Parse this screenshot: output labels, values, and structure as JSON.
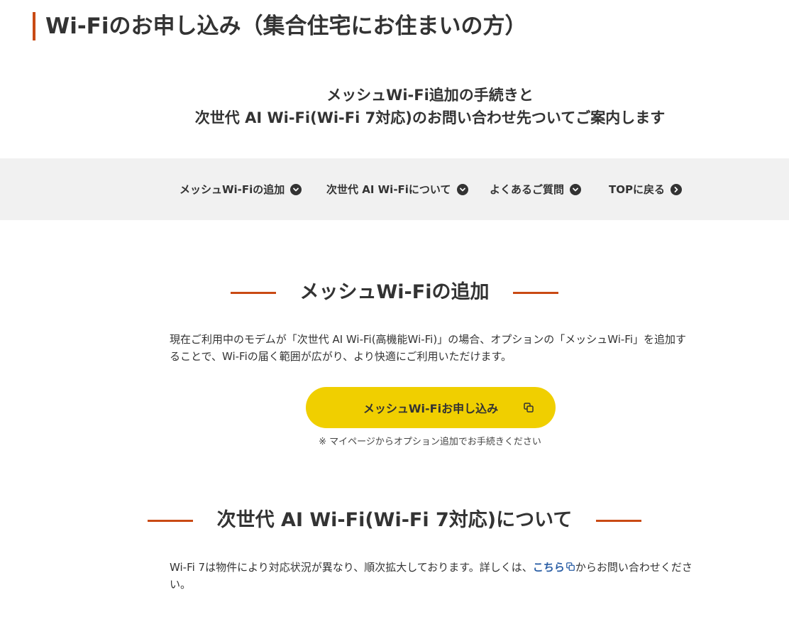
{
  "page": {
    "title": "Wi-Fiのお申し込み（集合住宅にお住まいの方）",
    "intro_line1": "メッシュWi-Fi追加の手続きと",
    "intro_line2": "次世代 AI Wi-Fi(Wi-Fi 7対応)のお問い合わせ先ついてご案内します"
  },
  "nav": [
    {
      "label": "メッシュWi-Fiの追加",
      "icon": "chevron-down-circle-icon"
    },
    {
      "label": "次世代 AI Wi-Fiについて",
      "icon": "chevron-down-circle-icon"
    },
    {
      "label": "よくあるご質問",
      "icon": "chevron-down-circle-icon"
    },
    {
      "label": "TOPに戻る",
      "icon": "chevron-right-circle-icon"
    }
  ],
  "mesh_section": {
    "heading": "メッシュWi-Fiの追加",
    "body": "現在ご利用中のモデムが「次世代 AI Wi-Fi(高機能Wi-Fi)」の場合、オプションの「メッシュWi-Fi」を追加することで、Wi-Fiの届く範囲が広がり、より快適にご利用いただけます。",
    "button_label": "メッシュWi-Fiお申し込み",
    "button_icon": "external-window-icon",
    "note": "※ マイページからオプション追加でお手続きください"
  },
  "ai_section": {
    "heading": "次世代 AI Wi-Fi(Wi-Fi 7対応)について",
    "body_before": "Wi-Fi 7は物件により対応状況が異なり、順次拡大しております。詳しくは、",
    "link_label": "こちら",
    "body_after": "からお問い合わせください。"
  },
  "colors": {
    "accent": "#c94a14",
    "cta": "#f0cf00",
    "link": "#2a5ea5",
    "nav_bg": "#f1f1f1",
    "text": "#333333"
  }
}
